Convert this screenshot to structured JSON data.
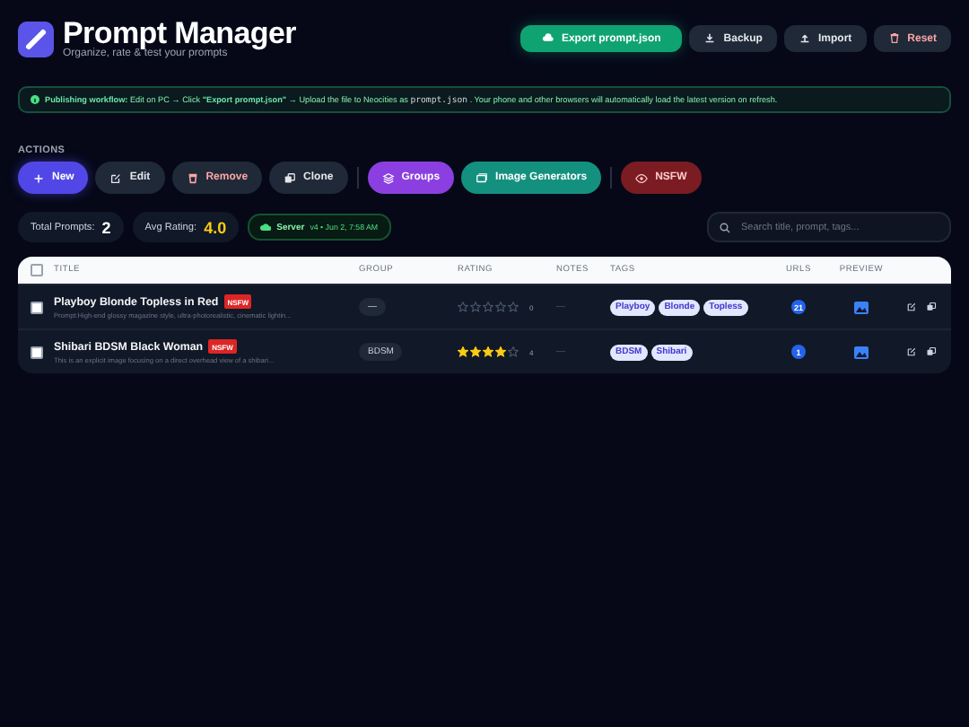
{
  "app": {
    "title": "Prompt Manager",
    "subtitle": "Organize, rate & test your prompts"
  },
  "header_buttons": [
    {
      "label": "Export prompt.json",
      "kind": "export"
    },
    {
      "label": "Backup",
      "kind": "backup"
    },
    {
      "label": "Import",
      "kind": "import"
    },
    {
      "label": "Reset",
      "kind": "reset"
    }
  ],
  "banner": {
    "lead": "**Publishing workflow:** Edit on PC → Click **\"Export prompt.json\"** → Upload the file to Neocities as",
    "code": "prompt.json",
    "tail": ". Your phone and other browsers will automatically load the latest version on refresh."
  },
  "actions": {
    "label": "ACTIONS",
    "buttons": [
      {
        "label": "New",
        "kind": "new"
      },
      {
        "label": "Edit",
        "kind": "edit"
      },
      {
        "label": "Remove",
        "kind": "remove"
      },
      {
        "label": "Clone",
        "kind": "clone"
      },
      {
        "label": "Groups",
        "kind": "groups"
      },
      {
        "label": "Image Generators",
        "kind": "generators"
      },
      {
        "label": "NSFW",
        "kind": "nsfw"
      }
    ]
  },
  "stats": [
    {
      "label": "Total Prompts:",
      "value": "2",
      "kind": "count"
    },
    {
      "label": "Avg Rating:",
      "value": "4.0",
      "kind": "rating"
    }
  ],
  "server": {
    "label": "Server",
    "detail": "v4 • Jun 2, 7:58 AM"
  },
  "search": {
    "placeholder": "Search title, prompt, tags..."
  },
  "table": {
    "select_all": {
      "checked": false
    },
    "columns": [
      "TITLE",
      "GROUP",
      "RATING",
      "NOTES",
      "TAGS",
      "URLS",
      "PREVIEW"
    ],
    "rows": [
      {
        "checked": false,
        "title": "Playboy Blonde Topless in Red",
        "badge": "NSFW",
        "description": "Prompt:High-end glossy magazine style, ultra-photorealistic, cinematic lightin...",
        "group": "—",
        "stars": 0,
        "rating": "0",
        "notes": "—",
        "tags": [
          "Playboy",
          "Blonde",
          "Topless"
        ],
        "urls": "21"
      },
      {
        "checked": false,
        "title": "Shibari BDSM Black Woman",
        "badge": "NSFW",
        "description": "This is an explicit image focusing on a direct overhead view of a shibari...",
        "group": "BDSM",
        "stars": 4,
        "rating": "4",
        "notes": "—",
        "tags": [
          "BDSM",
          "Shibari"
        ],
        "urls": "1"
      }
    ]
  }
}
